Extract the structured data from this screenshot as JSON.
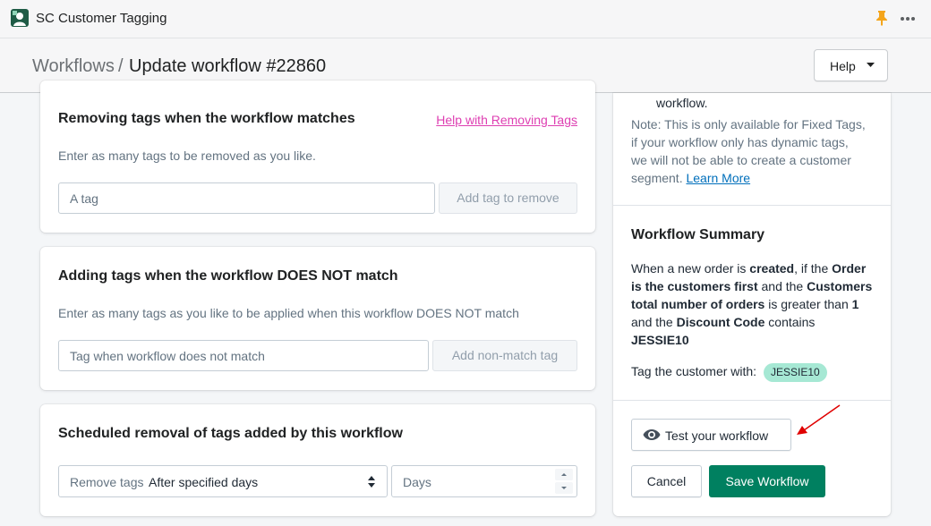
{
  "app": {
    "title": "SC Customer Tagging",
    "icons": [
      "app-logo-icon",
      "pin-icon",
      "more-icon"
    ]
  },
  "header": {
    "breadcrumb_parent": "Workflows",
    "breadcrumb_separator": "/",
    "page_title": "Update workflow #22860",
    "help_label": "Help"
  },
  "removing": {
    "title": "Removing tags when the workflow matches",
    "help_link": "Help with Removing Tags",
    "description": "Enter as many tags to be removed as you like.",
    "input_placeholder": "A tag",
    "button_label": "Add tag to remove"
  },
  "adding": {
    "title": "Adding tags when the workflow DOES NOT match",
    "description": "Enter as many tags as you like to be applied when this workflow DOES NOT match",
    "input_placeholder": "Tag when workflow does not match",
    "button_label": "Add non-match tag"
  },
  "scheduled": {
    "title": "Scheduled removal of tags added by this workflow",
    "select_prefix": "Remove tags",
    "select_value": "After specified days",
    "days_placeholder": "Days"
  },
  "sidebar": {
    "cutoff_text": "workflow.",
    "note_lines": [
      "Note: This is only available for Fixed Tags,",
      "if your workflow only has dynamic tags,",
      "we will not be able to create a customer",
      "segment."
    ],
    "learn_more": "Learn More",
    "summary_title": "Workflow Summary",
    "summary": {
      "t1": "When a new order is ",
      "b1": "created",
      "t2": ", if the ",
      "b2": "Order is the customers first",
      "t3": " and the ",
      "b3": "Customers total number of orders",
      "t4": " is greater than ",
      "b4": "1",
      "t5": " and the ",
      "b5": "Discount Code",
      "t6": " contains ",
      "b6": "JESSIE10"
    },
    "tag_label": "Tag the customer with:",
    "tag_value": "JESSIE10",
    "test_button": "Test your workflow",
    "cancel_button": "Cancel",
    "save_button": "Save Workflow"
  },
  "colors": {
    "primary_green": "#008060",
    "tag_badge": "#a6e8d4",
    "help_link_pink": "#de3fb2",
    "link_blue": "#006fbb",
    "annotation_red": "#e00000",
    "pin_orange": "#f4a51c"
  }
}
